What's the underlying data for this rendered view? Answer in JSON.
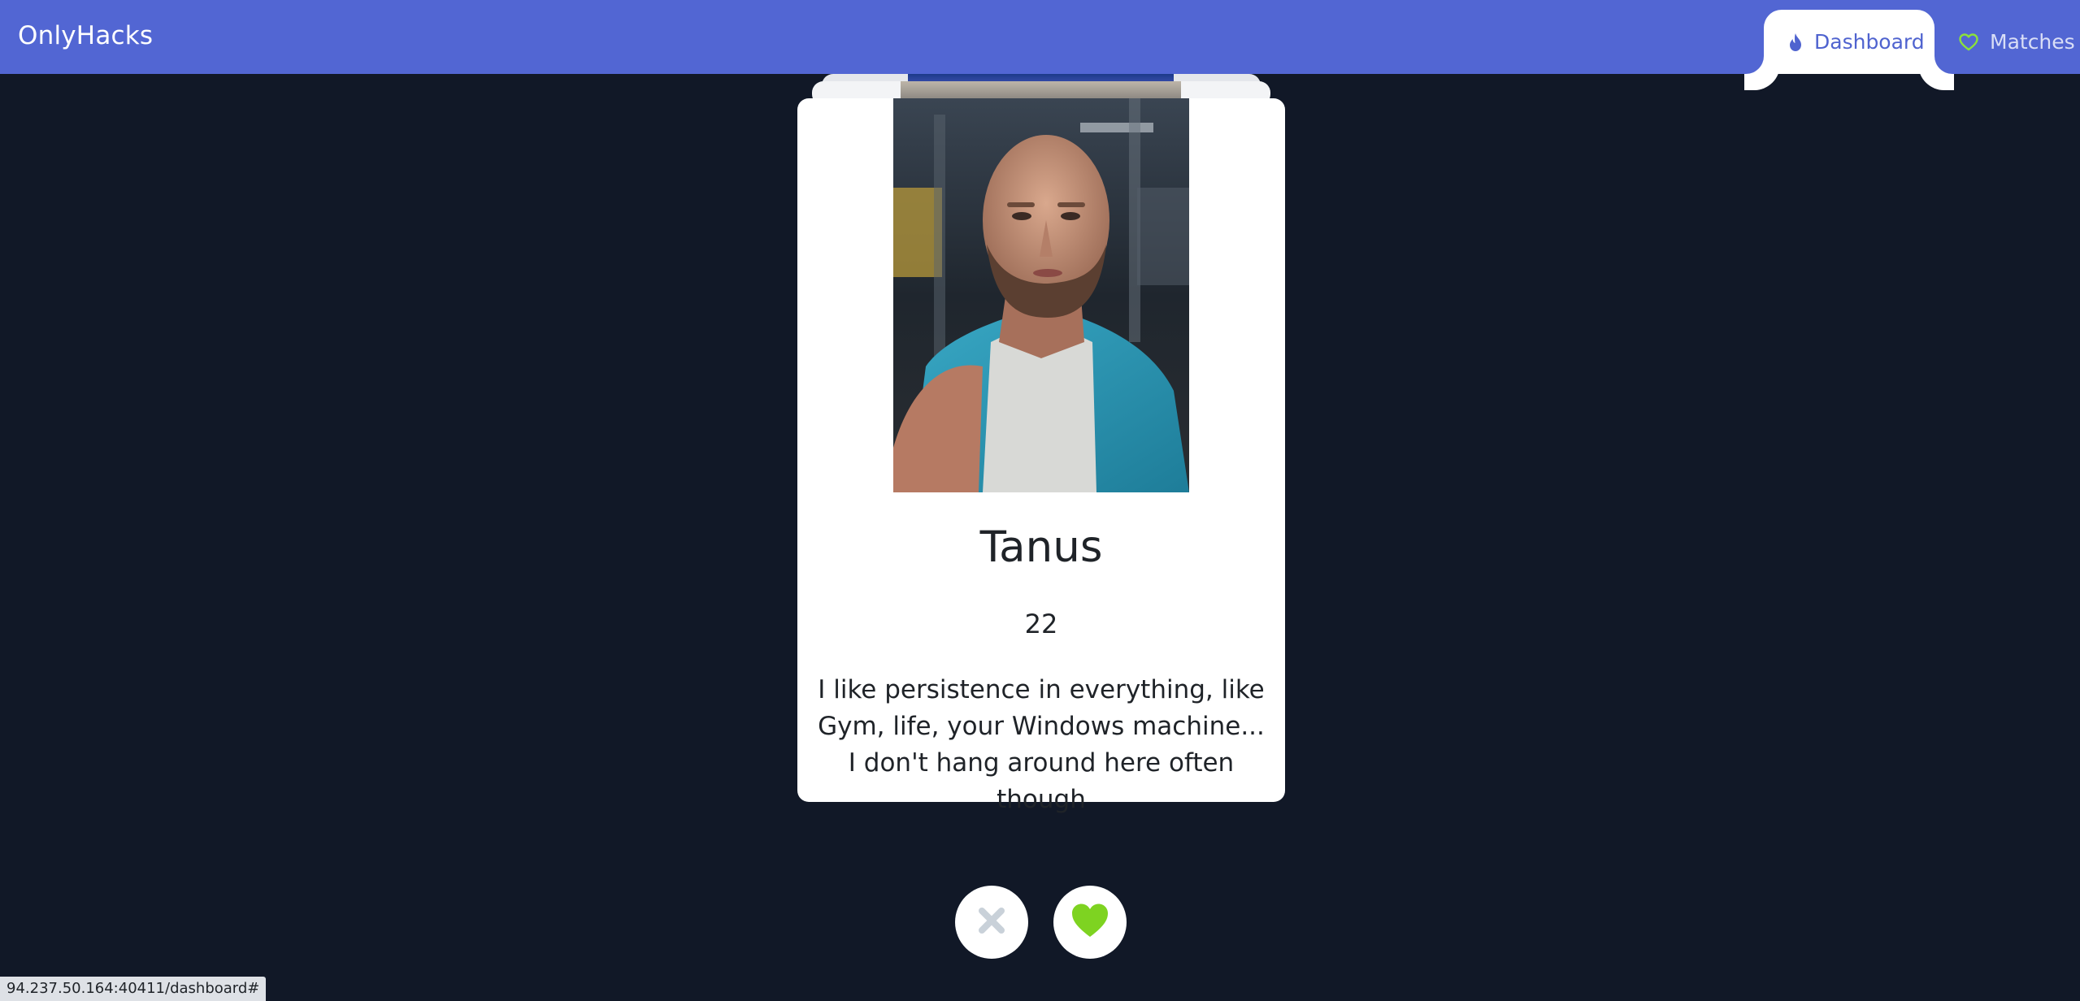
{
  "header": {
    "brand": "OnlyHacks",
    "nav": [
      {
        "label": "Dashboard",
        "icon": "flame-icon",
        "active": true
      },
      {
        "label": "Matches",
        "icon": "heart-outline-icon",
        "active": false
      }
    ]
  },
  "profile": {
    "name": "Tanus",
    "age": "22",
    "bio": "I like persistence in everything, like Gym, life, your Windows machine... I don't hang around here often though",
    "photo": "selfie-in-gym"
  },
  "actions": {
    "reject_icon": "x-icon",
    "like_icon": "heart-icon",
    "like_color": "#7ed321",
    "reject_color": "#c9d1d9"
  },
  "status_url": "94.237.50.164:40411/dashboard#",
  "colors": {
    "header_bg": "#5266d3",
    "page_bg": "#111827",
    "card_bg": "#ffffff",
    "accent": "#4f63cf"
  }
}
